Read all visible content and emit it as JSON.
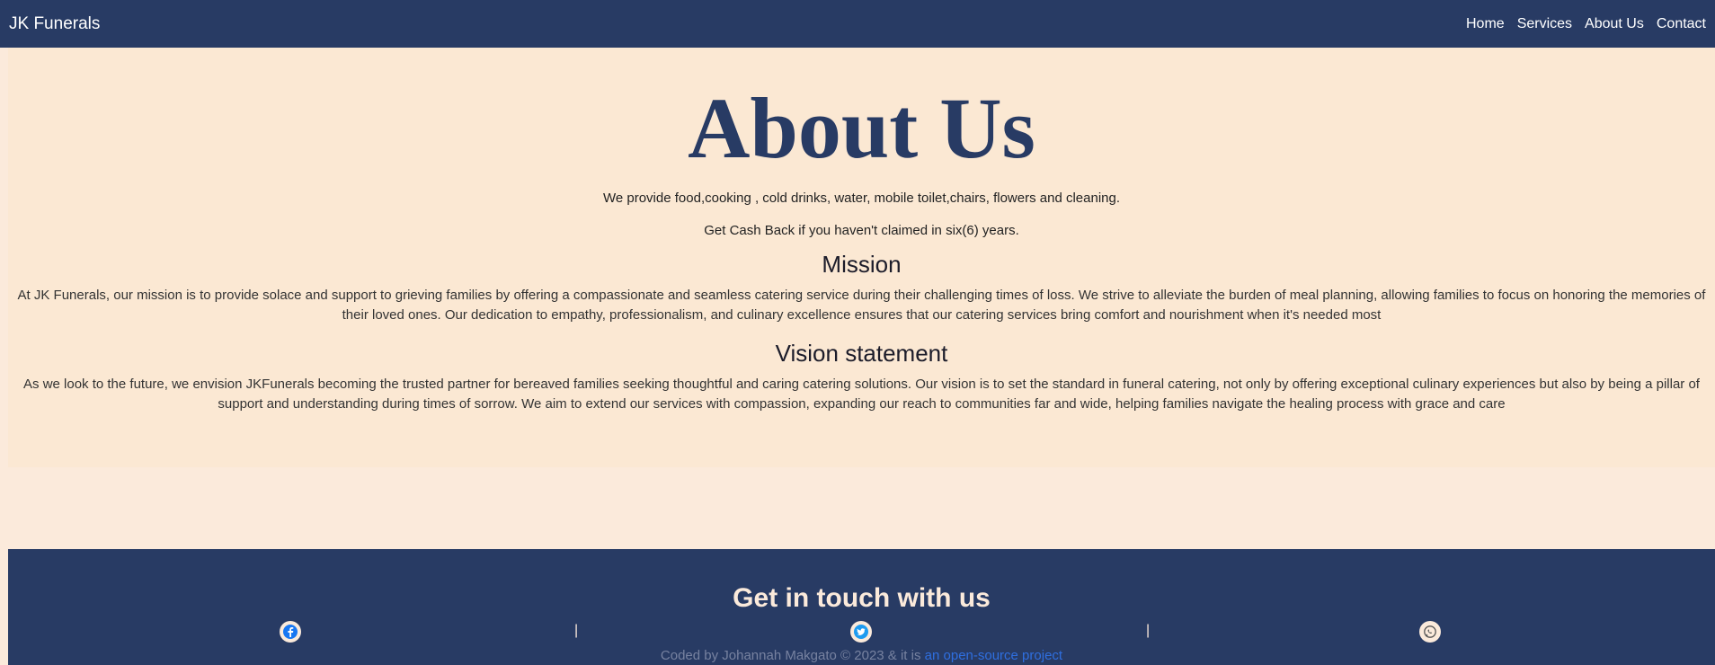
{
  "navbar": {
    "brand": "JK Funerals",
    "links": [
      "Home",
      "Services",
      "About Us",
      "Contact"
    ]
  },
  "about": {
    "title": "About Us",
    "intro_1": "We provide food,cooking , cold drinks, water, mobile toilet,chairs, flowers and cleaning.",
    "intro_2": "Get Cash Back if you haven't claimed in six(6) years.",
    "mission_heading": "Mission",
    "mission_text": "At JK Funerals, our mission is to provide solace and support to grieving families by offering a compassionate and seamless catering service during their challenging times of loss. We strive to alleviate the burden of meal planning, allowing families to focus on honoring the memories of their loved ones. Our dedication to empathy, professionalism, and culinary excellence ensures that our catering services bring comfort and nourishment when it's needed most",
    "vision_heading": "Vision statement",
    "vision_text": "As we look to the future, we envision JKFunerals becoming the trusted partner for bereaved families seeking thoughtful and caring catering solutions. Our vision is to set the standard in funeral catering, not only by offering exceptional culinary experiences but also by being a pillar of support and understanding during times of sorrow. We aim to extend our services with compassion, expanding our reach to communities far and wide, helping families navigate the healing process with grace and care"
  },
  "footer": {
    "title": "Get in touch with us",
    "separator": "|",
    "social": [
      "facebook-icon",
      "twitter-icon",
      "whatsapp-icon"
    ],
    "credit_text": "Coded by Johannah Makgato © 2023 & it is ",
    "credit_link": "an open-source project"
  },
  "colors": {
    "navbar_bg": "#283b64",
    "page_bg": "#fbeadb",
    "accent_link": "#2f6fe0"
  }
}
